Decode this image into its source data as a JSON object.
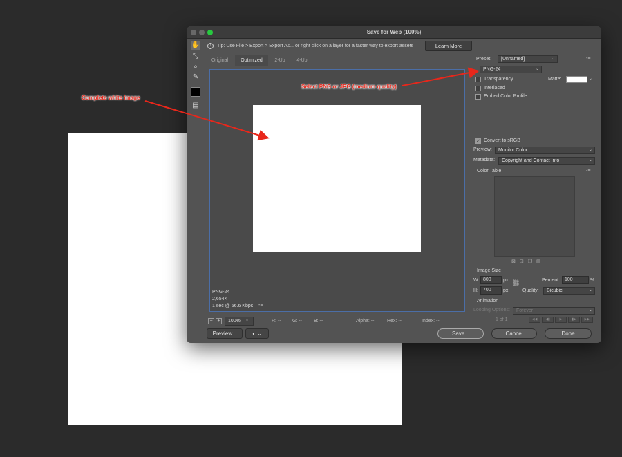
{
  "window": {
    "title": "Save for Web (100%)"
  },
  "tip": {
    "icon": "info-icon",
    "text": "Tip: Use File > Export > Export As...  or right click on a layer for a faster way to export assets",
    "learn_more": "Learn More"
  },
  "toolbar": {
    "icons": [
      "hand-icon",
      "slice-select-icon",
      "zoom-icon",
      "eyedropper-icon",
      "eyedropper-color-icon",
      "toggle-slices-icon"
    ]
  },
  "tabs": [
    {
      "label": "Original"
    },
    {
      "label": "Optimized",
      "active": true
    },
    {
      "label": "2-Up"
    },
    {
      "label": "4-Up"
    }
  ],
  "preview_info": {
    "format": "PNG-24",
    "size": "2,654K",
    "speed": "1 sec @ 56.6 Kbps",
    "menu": "-≡"
  },
  "status": {
    "zoom": "100%",
    "r": "R: --",
    "g": "G: --",
    "b": "B: --",
    "alpha": "Alpha: --",
    "hex": "Hex: --",
    "index": "Index: --"
  },
  "buttons": {
    "preview": "Preview...",
    "save": "Save...",
    "cancel": "Cancel",
    "done": "Done"
  },
  "settings": {
    "preset_label": "Preset:",
    "preset_value": "[Unnamed]",
    "format_value": "PNG-24",
    "transparency": {
      "label": "Transparency",
      "checked": false
    },
    "matte_label": "Matte:",
    "interlaced": {
      "label": "Interlaced",
      "checked": false
    },
    "embed_profile": {
      "label": "Embed Color Profile",
      "checked": false
    },
    "convert_srgb": {
      "label": "Convert to sRGB",
      "checked": true
    },
    "preview_label": "Preview:",
    "preview_value": "Monitor Color",
    "metadata_label": "Metadata:",
    "metadata_value": "Copyright and Contact Info",
    "color_table_label": "Color Table"
  },
  "image_size": {
    "label": "Image Size",
    "w_label": "W:",
    "width": "800",
    "h_label": "H:",
    "height": "700",
    "unit": "px",
    "percent_label": "Percent:",
    "percent": "100",
    "percent_sign": "%",
    "quality_label": "Quality:",
    "quality_value": "Bicubic"
  },
  "animation": {
    "label": "Animation",
    "looping_label": "Looping Options:",
    "looping_value": "Forever",
    "frame_count": "1 of 1"
  },
  "annotations": {
    "white_image": "Complete white image",
    "select_format": "Select PNG or JPG (medium quality)",
    "color": "#e8271b"
  }
}
